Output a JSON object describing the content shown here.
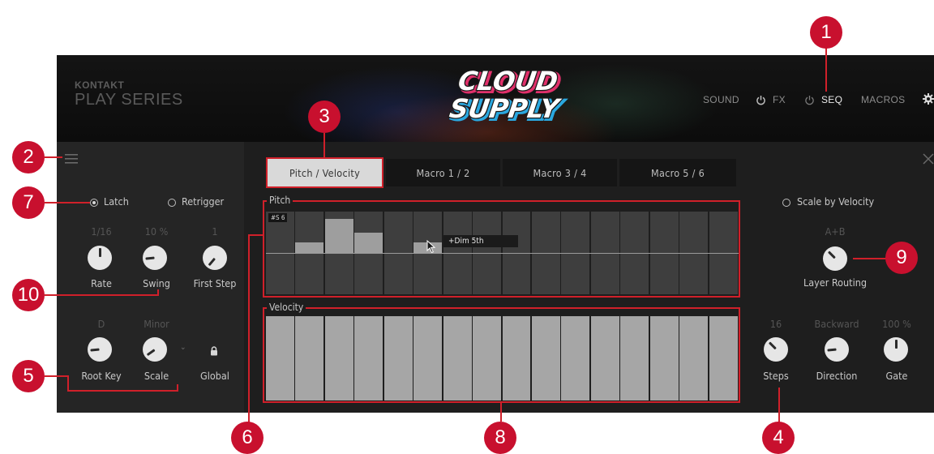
{
  "header": {
    "brand_small": "KONTAKT",
    "brand_large": "PLAY SERIES",
    "logo_line1": "CLOUD",
    "logo_line2": "SUPPLY",
    "nav": [
      {
        "label": "SOUND",
        "icon": "",
        "active": false
      },
      {
        "label": "FX",
        "icon": "power-icon",
        "active": false
      },
      {
        "label": "SEQ",
        "icon": "power-icon",
        "active": true
      },
      {
        "label": "MACROS",
        "icon": "",
        "active": false
      }
    ],
    "settings_icon": "gear-icon"
  },
  "tabs": [
    {
      "label": "Pitch / Velocity",
      "active": true
    },
    {
      "label": "Macro 1 / 2",
      "active": false
    },
    {
      "label": "Macro 3 / 4",
      "active": false
    },
    {
      "label": "Macro 5 / 6",
      "active": false
    }
  ],
  "left": {
    "latch_label": "Latch",
    "retrigger_label": "Retrigger",
    "knobs_row1": [
      {
        "value": "1/16",
        "label": "Rate"
      },
      {
        "value": "10 %",
        "label": "Swing"
      },
      {
        "value": "1",
        "label": "First Step"
      }
    ],
    "knobs_row2": [
      {
        "value": "D",
        "label": "Root Key"
      },
      {
        "value": "Minor",
        "label": "Scale"
      }
    ],
    "global_label": "Global"
  },
  "pitch": {
    "title": "Pitch",
    "step_tag": "#S 6",
    "tooltip": "+Dim 5th",
    "steps": 16,
    "values": [
      0,
      3,
      10,
      6,
      0,
      3,
      0,
      0,
      0,
      0,
      0,
      0,
      0,
      0,
      0,
      0
    ]
  },
  "velocity": {
    "title": "Velocity",
    "steps": 16,
    "values": [
      100,
      100,
      100,
      100,
      100,
      100,
      100,
      100,
      100,
      100,
      100,
      100,
      100,
      100,
      100,
      100
    ]
  },
  "right": {
    "scale_by_velocity_label": "Scale by Velocity",
    "layer_routing_value": "A+B",
    "layer_routing_label": "Layer Routing",
    "knobs": [
      {
        "value": "16",
        "label": "Steps"
      },
      {
        "value": "Backward",
        "label": "Direction"
      },
      {
        "value": "100 %",
        "label": "Gate"
      }
    ]
  },
  "callouts": [
    "1",
    "2",
    "3",
    "4",
    "5",
    "6",
    "7",
    "8",
    "9",
    "10"
  ],
  "colors": {
    "callout": "#c8102e",
    "highlight": "#d0202a"
  }
}
